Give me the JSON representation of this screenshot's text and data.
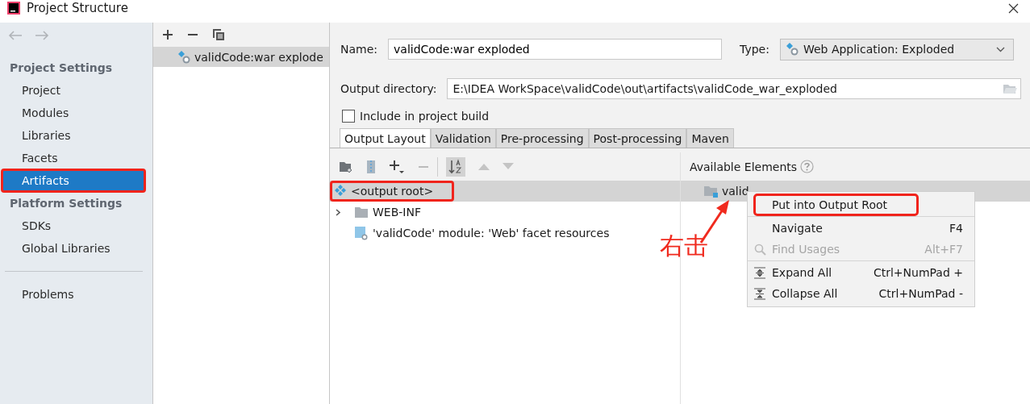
{
  "window": {
    "title": "Project Structure"
  },
  "sidebar": {
    "sections": [
      {
        "title": "Project Settings",
        "items": [
          {
            "label": "Project",
            "selected": false,
            "highlighted": false
          },
          {
            "label": "Modules",
            "selected": false,
            "highlighted": false
          },
          {
            "label": "Libraries",
            "selected": false,
            "highlighted": false
          },
          {
            "label": "Facets",
            "selected": false,
            "highlighted": false
          },
          {
            "label": "Artifacts",
            "selected": true,
            "highlighted": true
          }
        ]
      },
      {
        "title": "Platform Settings",
        "items": [
          {
            "label": "SDKs",
            "selected": false,
            "highlighted": false
          },
          {
            "label": "Global Libraries",
            "selected": false,
            "highlighted": false
          }
        ]
      }
    ],
    "bottom_items": [
      {
        "label": "Problems",
        "selected": false,
        "highlighted": false
      }
    ]
  },
  "artifacts": [
    {
      "label": "validCode:war explode",
      "selected": true
    }
  ],
  "form": {
    "name_label": "Name:",
    "name_value": "validCode:war exploded",
    "type_label": "Type:",
    "type_value": "Web Application: Exploded",
    "output_label": "Output directory:",
    "output_value": "E:\\IDEA WorkSpace\\validCode\\out\\artifacts\\validCode_war_exploded",
    "include_label": "Include in project build",
    "include_checked": false
  },
  "tabs": [
    {
      "label": "Output Layout",
      "selected": true
    },
    {
      "label": "Validation",
      "selected": false
    },
    {
      "label": "Pre-processing",
      "selected": false
    },
    {
      "label": "Post-processing",
      "selected": false
    },
    {
      "label": "Maven",
      "selected": false
    }
  ],
  "layout_tree": [
    {
      "label": "<output root>",
      "kind": "root",
      "selected": true,
      "highlighted": true
    },
    {
      "label": "WEB-INF",
      "kind": "folder",
      "selected": false,
      "highlighted": false,
      "expanded": false
    },
    {
      "label": "'validCode' module: 'Web' facet resources",
      "kind": "facet",
      "selected": false,
      "highlighted": false
    }
  ],
  "available": {
    "title": "Available Elements",
    "items": [
      {
        "label": "valid",
        "selected": true
      }
    ]
  },
  "context_menu": [
    {
      "label": "Put into Output Root",
      "disabled": false,
      "highlighted": true,
      "kind": "plain",
      "separator_before": false
    },
    {
      "label": "Navigate",
      "shortcut": "F4",
      "disabled": false,
      "highlighted": false,
      "kind": "plain",
      "separator_before": true
    },
    {
      "label": "Find Usages",
      "shortcut": "Alt+F7",
      "disabled": true,
      "highlighted": false,
      "kind": "search",
      "separator_before": false
    },
    {
      "label": "Expand All",
      "shortcut": "Ctrl+NumPad +",
      "disabled": false,
      "highlighted": false,
      "kind": "expand",
      "separator_before": true
    },
    {
      "label": "Collapse All",
      "shortcut": "Ctrl+NumPad -",
      "disabled": false,
      "highlighted": false,
      "kind": "collapse",
      "separator_before": false
    }
  ],
  "annotation": {
    "text": "右击"
  }
}
